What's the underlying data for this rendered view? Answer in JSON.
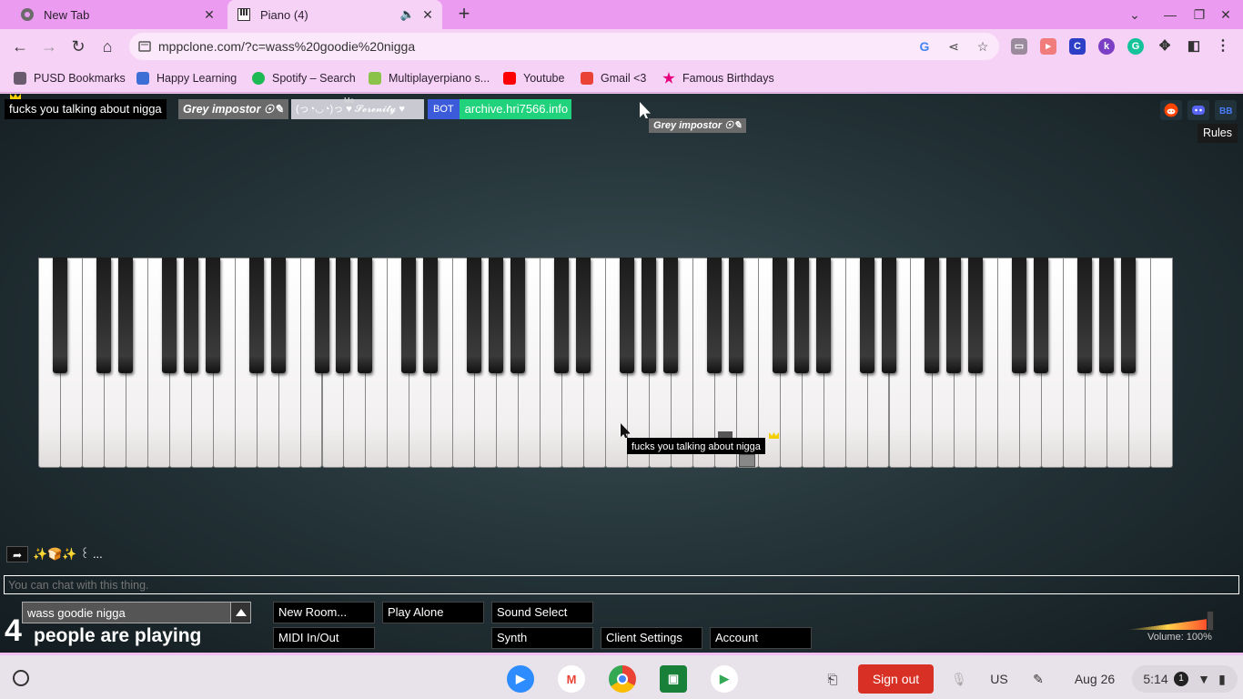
{
  "browser": {
    "tabs": [
      {
        "title": "New Tab",
        "active": false
      },
      {
        "title": "Piano (4)",
        "active": true
      }
    ],
    "url": "mppclone.com/?c=wass%20goodie%20nigga",
    "bookmarks": [
      {
        "label": "PUSD Bookmarks",
        "icon": "folder-icon",
        "color": "#6b5b6e"
      },
      {
        "label": "Happy Learning",
        "icon": "happy-learning-icon",
        "color": "#3c6ed6"
      },
      {
        "label": "Spotify – Search",
        "icon": "spotify-icon",
        "color": "#1db954"
      },
      {
        "label": "Multiplayerpiano s...",
        "icon": "mpp-icon",
        "color": "#8bc34a"
      },
      {
        "label": "Youtube",
        "icon": "youtube-icon",
        "color": "#ff0000"
      },
      {
        "label": "Gmail <3",
        "icon": "gmail-icon",
        "color": "#ea4335"
      },
      {
        "label": "Famous Birthdays",
        "icon": "famous-birthdays-icon",
        "color": "#e6007e"
      }
    ]
  },
  "mpp": {
    "participants": [
      {
        "name": "fucks you talking about nigga",
        "is_me": true,
        "crown": true,
        "color": "#000000"
      },
      {
        "name": "Grey impostor ☉✎",
        "color": "#6a6a6a"
      },
      {
        "name": "(っ◔◡◔)っ ♥ 𝓢𝓮𝓻𝓮𝓷𝓲𝓽𝔂 ♥",
        "me_label": "Me",
        "color": "#c9c9d2"
      },
      {
        "name": "archive.hri7566.info",
        "bot": "BOT",
        "color": "#1fd27b"
      }
    ],
    "floating_cursor_name": "Grey impostor ☉✎",
    "piano_cursor_name": "fucks you talking about nigga",
    "rules_label": "Rules",
    "chat": {
      "message": "✨🍞✨ ꒰ ... ",
      "placeholder": "You can chat with this thing."
    },
    "room_name": "wass goodie nigga",
    "player_count": "4",
    "players_text": "people are playing",
    "buttons": {
      "new_room": "New Room...",
      "play_alone": "Play Alone",
      "sound_select": "Sound Select",
      "midi": "MIDI In/Out",
      "synth": "Synth",
      "client_settings": "Client Settings",
      "account": "Account"
    },
    "volume_label": "Volume: 100%",
    "volume": 1.0
  },
  "shelf": {
    "sign_out": "Sign out",
    "lang": "US",
    "date": "Aug 26",
    "time": "5:14",
    "notification_count": "1"
  }
}
